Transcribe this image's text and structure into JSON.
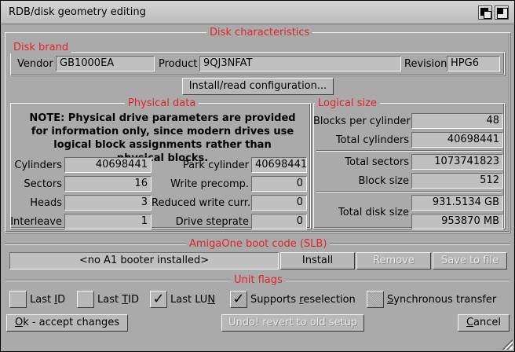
{
  "window": {
    "title": "RDB/disk geometry editing"
  },
  "disk_characteristics": {
    "heading": "Disk characteristics",
    "disk_brand": {
      "heading": "Disk brand",
      "vendor_label": "Vendor",
      "vendor_value": "GB1000EA",
      "product_label": "Product",
      "product_value": "9QJ3NFAT",
      "revision_label": "Revision",
      "revision_value": "HPG6"
    },
    "install_button": "Install/read configuration...",
    "physical": {
      "heading": "Physical data",
      "note": "NOTE: Physical drive parameters are provided for information only, since modern drives use logical block assignments rather than physical blocks.",
      "cylinders_label": "Cylinders",
      "cylinders": "40698441",
      "sectors_label": "Sectors",
      "sectors": "16",
      "heads_label": "Heads",
      "heads": "3",
      "interleave_label": "Interleave",
      "interleave": "1",
      "park_label": "Park cylinder",
      "park": "40698441",
      "precomp_label": "Write precomp.",
      "precomp": "0",
      "reduced_label": "Reduced write curr.",
      "reduced": "0",
      "steprate_label": "Drive steprate",
      "steprate": "0"
    },
    "logical": {
      "heading": "Logical size",
      "bpc_label": "Blocks per cylinder",
      "bpc": "48",
      "total_cyl_label": "Total cylinders",
      "total_cyl": "40698441",
      "total_sectors_label": "Total sectors",
      "total_sectors": "1073741823",
      "block_size_label": "Block size",
      "block_size": "512",
      "total_disk_label": "Total disk size",
      "total_gb": "931.5134 GB",
      "total_mb": "953870 MB"
    }
  },
  "boot": {
    "heading": "AmigaOne boot code (SLB)",
    "status": "<no A1 booter installed>",
    "install": "Install",
    "remove": "Remove",
    "save": "Save to file"
  },
  "unit_flags": {
    "heading": "Unit flags",
    "last_id": {
      "pre": "Last ",
      "key": "I",
      "post": "D",
      "checked": false
    },
    "last_tid": {
      "pre": "Last ",
      "key": "T",
      "post": "ID",
      "checked": false
    },
    "last_lun": {
      "pre": "Last LU",
      "key": "N",
      "post": "",
      "checked": true
    },
    "supports_reselection": {
      "pre": "Supports ",
      "key": "r",
      "post": "eselection",
      "checked": true
    },
    "synchronous_transfer": {
      "pre": "",
      "key": "S",
      "post": "ynchronous transfer",
      "checked": false
    }
  },
  "footer": {
    "ok": {
      "key": "O",
      "post": "k - accept changes"
    },
    "undo": "Undo! revert to old setup",
    "cancel": {
      "key": "C",
      "post": "ancel"
    }
  }
}
